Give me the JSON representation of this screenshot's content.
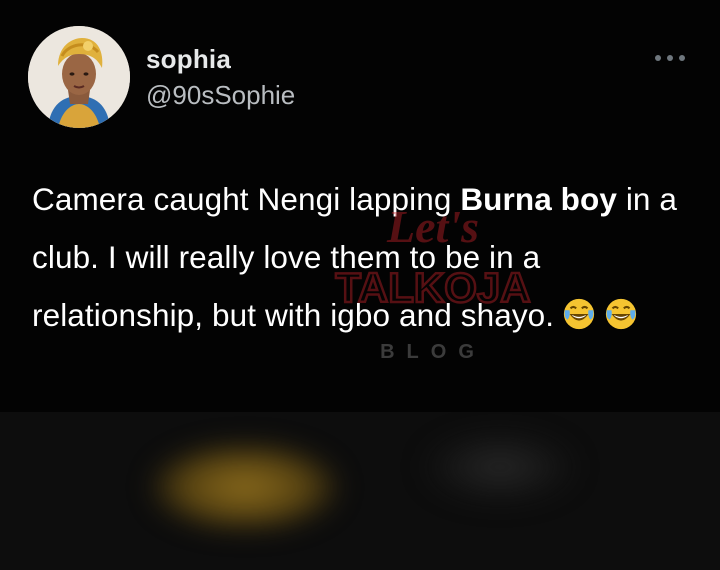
{
  "tweet": {
    "display_name": "sophia",
    "handle": "@90sSophie",
    "text_parts": [
      "Camera caught Nengi lapping ",
      "Burna boy",
      " in a club. I will really love them to be in a relationship, but with igbo and shayo."
    ],
    "emojis": [
      "face-with-tears-of-joy",
      "face-with-tears-of-joy"
    ]
  },
  "watermark": {
    "line1": "Let's",
    "line2": "TALKOJA",
    "line3": "BLOG"
  },
  "colors": {
    "background": "#030303",
    "text": "#ffffff",
    "handle": "#b9bdc1",
    "watermark": "#c8242b"
  }
}
